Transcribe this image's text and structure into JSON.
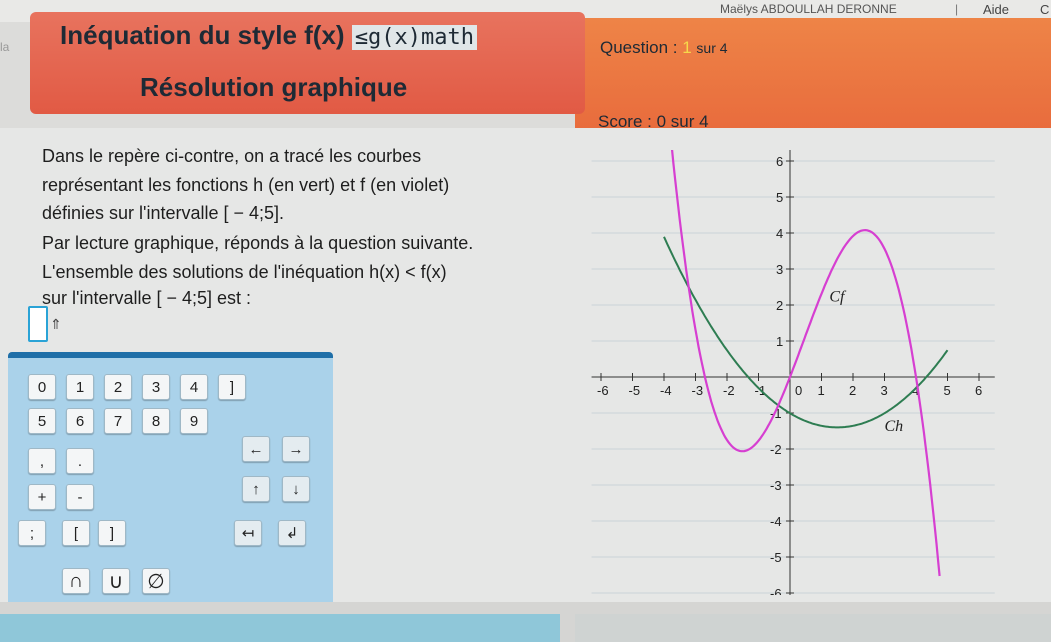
{
  "topbar": {
    "user": "Maëlys ABDOULLAH DERONNE",
    "separator": "|",
    "help": "Aide",
    "help_extra": "C"
  },
  "left_edge_text": "la",
  "header": {
    "title_prefix": "Inéquation du style ",
    "title_fx": "f(x)",
    "title_highlight": "≤g(x)",
    "title_suffix": "math",
    "subtitle": "Résolution graphique",
    "question_label": "Question : ",
    "question_current": "1",
    "question_total": "sur 4",
    "score": "Score : 0 sur 4"
  },
  "statement": {
    "line1": "Dans le repère ci-contre, on a tracé les courbes",
    "line2": "représentant les fonctions h (en vert) et f (en violet)",
    "line3": "définies sur l'intervalle [ − 4;5].",
    "line4": "Par lecture graphique, réponds à la question suivante.",
    "line5": "L'ensemble des solutions de l'inéquation h(x) < f(x)",
    "line6": "sur l'intervalle [ − 4;5] est :"
  },
  "answer": {
    "value": "",
    "caret": "⇑"
  },
  "keyboard": {
    "row1": [
      "0",
      "1",
      "2",
      "3",
      "4",
      "]"
    ],
    "row2": [
      "5",
      "6",
      "7",
      "8",
      "9"
    ],
    "row3": [
      ",",
      "."
    ],
    "row3_arrows": [
      "←",
      "→"
    ],
    "row4": [
      "+",
      "-"
    ],
    "row4_arrows": [
      "↑",
      "↓"
    ],
    "row5": [
      ";",
      "[",
      "]"
    ],
    "row5_arrows": [
      "↤",
      "↲"
    ],
    "row6": [
      "∩",
      "∪",
      "∅"
    ]
  },
  "graph": {
    "x_ticks": [
      "-6",
      "-5",
      "-4",
      "-3",
      "-2",
      "-1",
      "0",
      "1",
      "2",
      "3",
      "4",
      "5",
      "6"
    ],
    "y_ticks": [
      "6",
      "5",
      "4",
      "3",
      "2",
      "1",
      "-1",
      "-2",
      "-3",
      "-4",
      "-5",
      "-6"
    ],
    "label_f": "Cf",
    "label_h": "Ch",
    "color_h": "#2e7d52",
    "color_f": "#d63fd1"
  },
  "colors": {
    "banner_left": "#e15a44",
    "banner_right": "#e86a3c",
    "keyboard_bg": "#aad2ea",
    "accent": "#1f6fa8"
  }
}
